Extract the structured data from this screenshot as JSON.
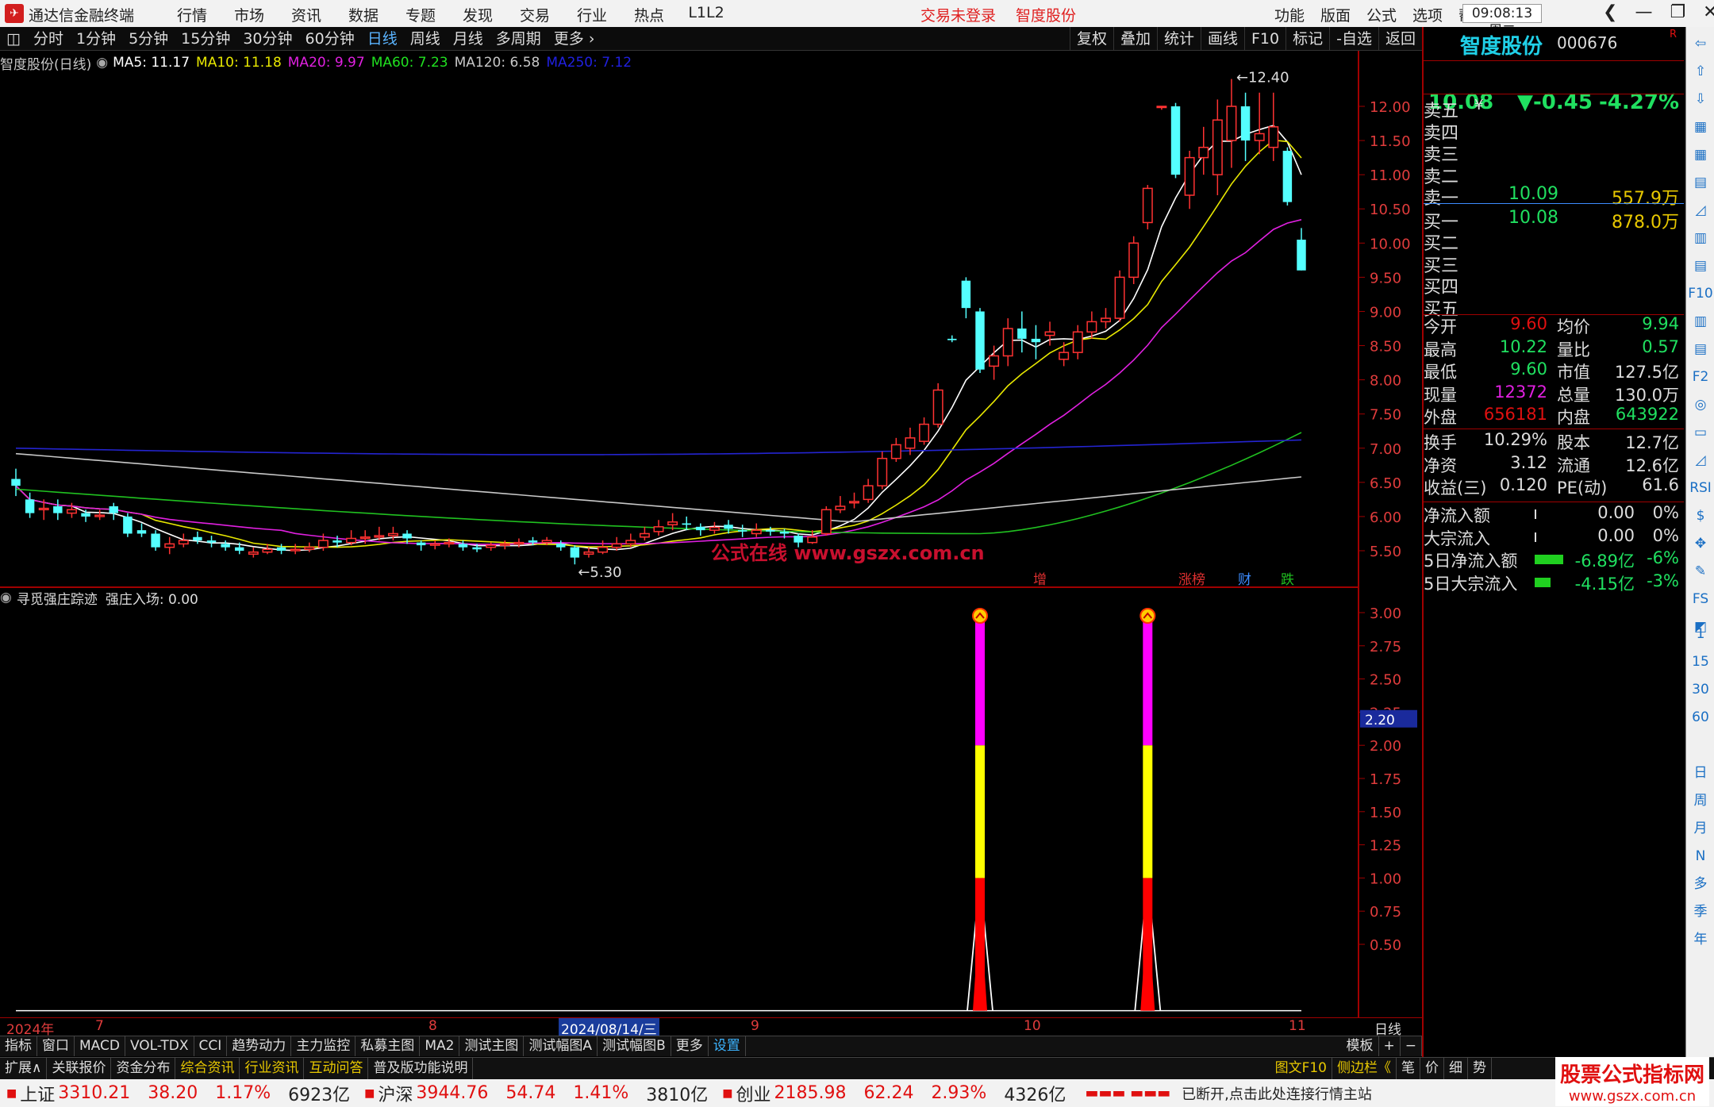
{
  "titlebar": {
    "logo": "✈",
    "app_title": "通达信金融终端",
    "menu": [
      "行情",
      "市场",
      "资讯",
      "数据",
      "专题",
      "发现",
      "交易",
      "行业",
      "热点",
      "L1L2"
    ],
    "status_trade": "交易未登录",
    "status_stock": "智度股份",
    "right_menu": [
      "功能",
      "版面",
      "公式",
      "选项",
      "帮助"
    ],
    "clock": "09:08:13",
    "weekday": "周二",
    "win_buttons": [
      "❮",
      "—",
      "❐",
      "✕"
    ]
  },
  "period_bar": {
    "tabs": [
      "分时",
      "1分钟",
      "5分钟",
      "15分钟",
      "30分钟",
      "60分钟",
      "日线",
      "周线",
      "月线",
      "多周期",
      "更多 ›"
    ],
    "active": "日线",
    "right_tabs": [
      "复权",
      "叠加",
      "统计",
      "画线",
      "F10",
      "标记",
      "-自选",
      "返回"
    ]
  },
  "main_info": {
    "title": "智度股份(日线)",
    "ma": [
      {
        "label": "MA5: 11.17",
        "color": "#ffffff"
      },
      {
        "label": "MA10: 11.18",
        "color": "#e8e800"
      },
      {
        "label": "MA20: 9.97",
        "color": "#e020e0"
      },
      {
        "label": "MA60: 7.23",
        "color": "#20e020"
      },
      {
        "label": "MA120: 6.58",
        "color": "#c8c8c8"
      },
      {
        "label": "MA250: 7.12",
        "color": "#2020e0"
      }
    ]
  },
  "chart_annotations": {
    "high_label": "12.40",
    "low_label": "5.30",
    "watermark": "公式在线  www.gszx.com.cn",
    "badges": [
      {
        "text": "增",
        "color": "#e03030"
      },
      {
        "text": "涨榜",
        "color": "#e03030"
      },
      {
        "text": "财",
        "color": "#3c8cff"
      },
      {
        "text": "跌",
        "color": "#20c020"
      }
    ]
  },
  "sub_info": {
    "indicator": "寻觅强庄踪迹",
    "value_label": "强庄入场: 0.00"
  },
  "x_axis": {
    "labels": [
      "2024年",
      "7",
      "8",
      "2024/08/14/三",
      "9",
      "10",
      "11"
    ],
    "period_label": "日线"
  },
  "chart_data": [
    {
      "type": "candlestick",
      "ylim": [
        5.2,
        12.6
      ],
      "y_ticks": [
        "12.00",
        "11.50",
        "11.00",
        "10.50",
        "10.00",
        "9.50",
        "9.00",
        "8.50",
        "8.00",
        "7.50",
        "7.00",
        "6.50",
        "6.00",
        "5.50"
      ],
      "candles": [
        [
          6.55,
          6.45,
          6.7,
          6.3
        ],
        [
          6.25,
          6.05,
          6.35,
          5.98
        ],
        [
          6.1,
          6.12,
          6.25,
          5.95
        ],
        [
          6.15,
          6.05,
          6.25,
          5.95
        ],
        [
          6.05,
          6.1,
          6.2,
          5.98
        ],
        [
          6.05,
          6.0,
          6.1,
          5.92
        ],
        [
          6.0,
          6.02,
          6.1,
          5.95
        ],
        [
          6.15,
          6.05,
          6.2,
          5.95
        ],
        [
          6.0,
          5.75,
          6.05,
          5.7
        ],
        [
          5.8,
          5.75,
          5.9,
          5.7
        ],
        [
          5.75,
          5.55,
          5.8,
          5.5
        ],
        [
          5.55,
          5.6,
          5.7,
          5.45
        ],
        [
          5.6,
          5.65,
          5.75,
          5.55
        ],
        [
          5.7,
          5.65,
          5.78,
          5.6
        ],
        [
          5.65,
          5.62,
          5.72,
          5.55
        ],
        [
          5.6,
          5.55,
          5.65,
          5.5
        ],
        [
          5.55,
          5.5,
          5.62,
          5.45
        ],
        [
          5.45,
          5.48,
          5.55,
          5.4
        ],
        [
          5.48,
          5.52,
          5.6,
          5.45
        ],
        [
          5.55,
          5.5,
          5.6,
          5.45
        ],
        [
          5.5,
          5.52,
          5.6,
          5.45
        ],
        [
          5.52,
          5.55,
          5.62,
          5.48
        ],
        [
          5.55,
          5.65,
          5.75,
          5.5
        ],
        [
          5.65,
          5.62,
          5.72,
          5.55
        ],
        [
          5.62,
          5.68,
          5.8,
          5.58
        ],
        [
          5.68,
          5.7,
          5.8,
          5.6
        ],
        [
          5.7,
          5.72,
          5.85,
          5.65
        ],
        [
          5.72,
          5.75,
          5.85,
          5.65
        ],
        [
          5.75,
          5.68,
          5.8,
          5.6
        ],
        [
          5.62,
          5.58,
          5.65,
          5.5
        ],
        [
          5.58,
          5.6,
          5.65,
          5.52
        ],
        [
          5.6,
          5.62,
          5.68,
          5.55
        ],
        [
          5.6,
          5.55,
          5.65,
          5.5
        ],
        [
          5.55,
          5.52,
          5.6,
          5.48
        ],
        [
          5.55,
          5.58,
          5.62,
          5.5
        ],
        [
          5.58,
          5.6,
          5.65,
          5.52
        ],
        [
          5.6,
          5.62,
          5.68,
          5.55
        ],
        [
          5.65,
          5.62,
          5.7,
          5.58
        ],
        [
          5.62,
          5.65,
          5.7,
          5.58
        ],
        [
          5.6,
          5.55,
          5.65,
          5.5
        ],
        [
          5.55,
          5.4,
          5.58,
          5.3
        ],
        [
          5.45,
          5.48,
          5.55,
          5.4
        ],
        [
          5.48,
          5.55,
          5.65,
          5.45
        ],
        [
          5.55,
          5.6,
          5.7,
          5.5
        ],
        [
          5.6,
          5.65,
          5.75,
          5.55
        ],
        [
          5.7,
          5.75,
          5.85,
          5.65
        ],
        [
          5.78,
          5.85,
          5.95,
          5.72
        ],
        [
          5.88,
          5.92,
          6.05,
          5.8
        ],
        [
          5.9,
          5.88,
          6.0,
          5.8
        ],
        [
          5.85,
          5.8,
          5.9,
          5.72
        ],
        [
          5.8,
          5.84,
          5.92,
          5.75
        ],
        [
          5.88,
          5.82,
          5.95,
          5.75
        ],
        [
          5.8,
          5.78,
          5.88,
          5.7
        ],
        [
          5.75,
          5.8,
          5.9,
          5.7
        ],
        [
          5.8,
          5.78,
          5.85,
          5.72
        ],
        [
          5.78,
          5.75,
          5.82,
          5.68
        ],
        [
          5.72,
          5.62,
          5.75,
          5.55
        ],
        [
          5.62,
          5.7,
          5.8,
          5.6
        ],
        [
          5.75,
          6.1,
          6.15,
          5.72
        ],
        [
          6.1,
          6.15,
          6.3,
          6.05
        ],
        [
          6.2,
          6.22,
          6.35,
          6.12
        ],
        [
          6.25,
          6.45,
          6.55,
          6.2
        ],
        [
          6.45,
          6.85,
          6.95,
          6.4
        ],
        [
          6.85,
          7.05,
          7.15,
          6.8
        ],
        [
          7.0,
          7.15,
          7.3,
          6.9
        ],
        [
          7.1,
          7.35,
          7.45,
          7.05
        ],
        [
          7.35,
          7.85,
          7.95,
          7.3
        ],
        [
          8.6,
          8.58,
          8.65,
          8.55
        ],
        [
          9.45,
          9.05,
          9.5,
          8.9
        ],
        [
          9.0,
          8.15,
          9.05,
          8.1
        ],
        [
          8.2,
          8.35,
          8.5,
          8.0
        ],
        [
          8.35,
          8.75,
          8.9,
          8.2
        ],
        [
          8.75,
          8.6,
          9.0,
          8.4
        ],
        [
          8.6,
          8.55,
          8.8,
          8.3
        ],
        [
          8.65,
          8.7,
          8.85,
          8.5
        ],
        [
          8.3,
          8.4,
          8.55,
          8.2
        ],
        [
          8.4,
          8.7,
          8.8,
          8.3
        ],
        [
          8.7,
          8.85,
          9.0,
          8.6
        ],
        [
          8.85,
          8.9,
          9.05,
          8.75
        ],
        [
          8.9,
          9.5,
          9.6,
          8.85
        ],
        [
          9.5,
          10.0,
          10.1,
          9.4
        ],
        [
          10.3,
          10.8,
          10.85,
          10.2
        ],
        [
          12.0,
          12.0,
          12.0,
          11.95
        ],
        [
          12.0,
          11.0,
          12.05,
          10.95
        ],
        [
          10.7,
          11.25,
          11.35,
          10.5
        ],
        [
          11.25,
          11.4,
          11.7,
          11.0
        ],
        [
          11.0,
          11.8,
          12.1,
          10.7
        ],
        [
          11.5,
          12.0,
          12.4,
          11.1
        ],
        [
          12.0,
          11.5,
          12.2,
          11.2
        ],
        [
          11.5,
          11.6,
          12.2,
          11.3
        ],
        [
          11.4,
          11.7,
          12.2,
          11.2
        ],
        [
          11.35,
          10.6,
          11.4,
          10.55
        ],
        [
          10.05,
          9.6,
          10.22,
          9.6
        ]
      ],
      "ma_lines": [
        {
          "name": "MA5",
          "color": "#ffffff"
        },
        {
          "name": "MA10",
          "color": "#e8e800"
        },
        {
          "name": "MA20",
          "color": "#e020e0"
        },
        {
          "name": "MA60",
          "color": "#20c020"
        },
        {
          "name": "MA120",
          "color": "#c8c8c8"
        },
        {
          "name": "MA250",
          "color": "#2424d0"
        }
      ]
    },
    {
      "type": "bar",
      "ylim": [
        0,
        3.1
      ],
      "y_ticks": [
        "3.00",
        "2.75",
        "2.50",
        "2.25",
        "2.00",
        "1.75",
        "1.50",
        "1.25",
        "1.00",
        "0.75",
        "0.50"
      ],
      "current_tag": "2.20",
      "signals": [
        {
          "index": 69,
          "segments": [
            {
              "from": 0,
              "to": 1,
              "color": "#ff0000"
            },
            {
              "from": 1,
              "to": 2,
              "color": "#ffff00"
            },
            {
              "from": 2,
              "to": 3,
              "color": "#ff00ff"
            }
          ]
        },
        {
          "index": 81,
          "segments": [
            {
              "from": 0,
              "to": 1,
              "color": "#ff0000"
            },
            {
              "from": 1,
              "to": 2,
              "color": "#ffff00"
            },
            {
              "from": 2,
              "to": 3,
              "color": "#ff00ff"
            }
          ]
        }
      ]
    }
  ],
  "right_panel": {
    "name": "智度股份",
    "code": "000676",
    "badge": "R",
    "price": "10.08",
    "change": "▼-0.45",
    "pct": "-4.27%",
    "asks": [
      {
        "label": "卖五",
        "price": "",
        "vol": "",
        "extra": "¥"
      },
      {
        "label": "卖四",
        "price": "",
        "vol": ""
      },
      {
        "label": "卖三",
        "price": "",
        "vol": ""
      },
      {
        "label": "卖二",
        "price": "",
        "vol": ""
      },
      {
        "label": "卖一",
        "price": "10.09",
        "vol": "557.9万"
      }
    ],
    "bids": [
      {
        "label": "买一",
        "price": "10.08",
        "vol": "878.0万"
      },
      {
        "label": "买二",
        "price": "",
        "vol": ""
      },
      {
        "label": "买三",
        "price": "",
        "vol": ""
      },
      {
        "label": "买四",
        "price": "",
        "vol": ""
      },
      {
        "label": "买五",
        "price": "",
        "vol": ""
      }
    ],
    "stats": [
      {
        "l1": "今开",
        "v1": "9.60",
        "c1": "r",
        "l2": "均价",
        "v2": "9.94",
        "c2": "g"
      },
      {
        "l1": "最高",
        "v1": "10.22",
        "c1": "g",
        "l2": "量比",
        "v2": "0.57",
        "c2": "g"
      },
      {
        "l1": "最低",
        "v1": "9.60",
        "c1": "g",
        "l2": "市值",
        "v2": "127.5亿",
        "c2": "w"
      },
      {
        "l1": "现量",
        "v1": "12372",
        "c1": "m",
        "l2": "总量",
        "v2": "130.0万",
        "c2": "w"
      },
      {
        "l1": "外盘",
        "v1": "656181",
        "c1": "r",
        "l2": "内盘",
        "v2": "643922",
        "c2": "g"
      },
      {
        "l1": "换手",
        "v1": "10.29%",
        "c1": "w",
        "l2": "股本",
        "v2": "12.7亿",
        "c2": "w"
      },
      {
        "l1": "净资",
        "v1": "3.12",
        "c1": "w",
        "l2": "流通",
        "v2": "12.6亿",
        "c2": "w"
      },
      {
        "l1": "收益(三)",
        "v1": "0.120",
        "c1": "w",
        "l2": "PE(动)",
        "v2": "61.6",
        "c2": "w"
      }
    ],
    "flows": [
      {
        "label": "净流入额",
        "value": "0.00",
        "pct": "0%",
        "c": "w",
        "bar": 0
      },
      {
        "label": "大宗流入",
        "value": "0.00",
        "pct": "0%",
        "c": "w",
        "bar": 0
      },
      {
        "label": "5日净流入额",
        "value": "-6.89亿",
        "pct": "-6%",
        "c": "g",
        "bar": 36
      },
      {
        "label": "5日大宗流入",
        "value": "-4.15亿",
        "pct": "-3%",
        "c": "g",
        "bar": 20
      }
    ]
  },
  "right_toolbar": {
    "icons": [
      "⇦",
      "⇧",
      "⇩",
      "▦",
      "▦",
      "▤",
      "◿",
      "▥",
      "▤",
      "F10",
      "▥",
      "▤",
      "F2",
      "◎",
      "▭",
      "◿",
      "RSI",
      "$",
      "✥",
      "✎",
      "FS",
      "◩"
    ],
    "nums": [
      "1",
      "15",
      "30",
      "60"
    ],
    "periods": [
      "日",
      "周",
      "月",
      "N",
      "多",
      "季",
      "年"
    ]
  },
  "tab_bar1": {
    "tabs": [
      "指标",
      "窗口",
      "MACD",
      "VOL-TDX",
      "CCI",
      "趋势动力",
      "主力监控",
      "私募主图",
      "MA2",
      "测试主图",
      "测试幅图A",
      "测试幅图B",
      "更多",
      "设置"
    ],
    "right": [
      "模板",
      "+",
      "−"
    ]
  },
  "tab_bar2": {
    "tabs": [
      "扩展∧",
      "关联报价",
      "资金分布",
      "综合资讯",
      "行业资讯",
      "互动问答",
      "普及版功能说明"
    ],
    "yellow": [
      "综合资讯",
      "行业资讯",
      "互动问答"
    ],
    "right": [
      "图文F10",
      "侧边栏《",
      "笔",
      "价",
      "细",
      "势"
    ]
  },
  "bottom_index": {
    "items": [
      {
        "name": "上证",
        "val": "3310.21",
        "chg": "38.20",
        "pct": "1.17%",
        "amt": "6923亿"
      },
      {
        "name": "沪深",
        "val": "3944.76",
        "chg": "54.74",
        "pct": "1.41%",
        "amt": "3810亿"
      },
      {
        "name": "创业",
        "val": "2185.98",
        "chg": "62.24",
        "pct": "2.93%",
        "amt": "4326亿"
      }
    ],
    "status": "已断开,点击此处连接行情主站",
    "site_cn": "股票公式指标网",
    "site_en": "www.gszx.com.cn"
  }
}
